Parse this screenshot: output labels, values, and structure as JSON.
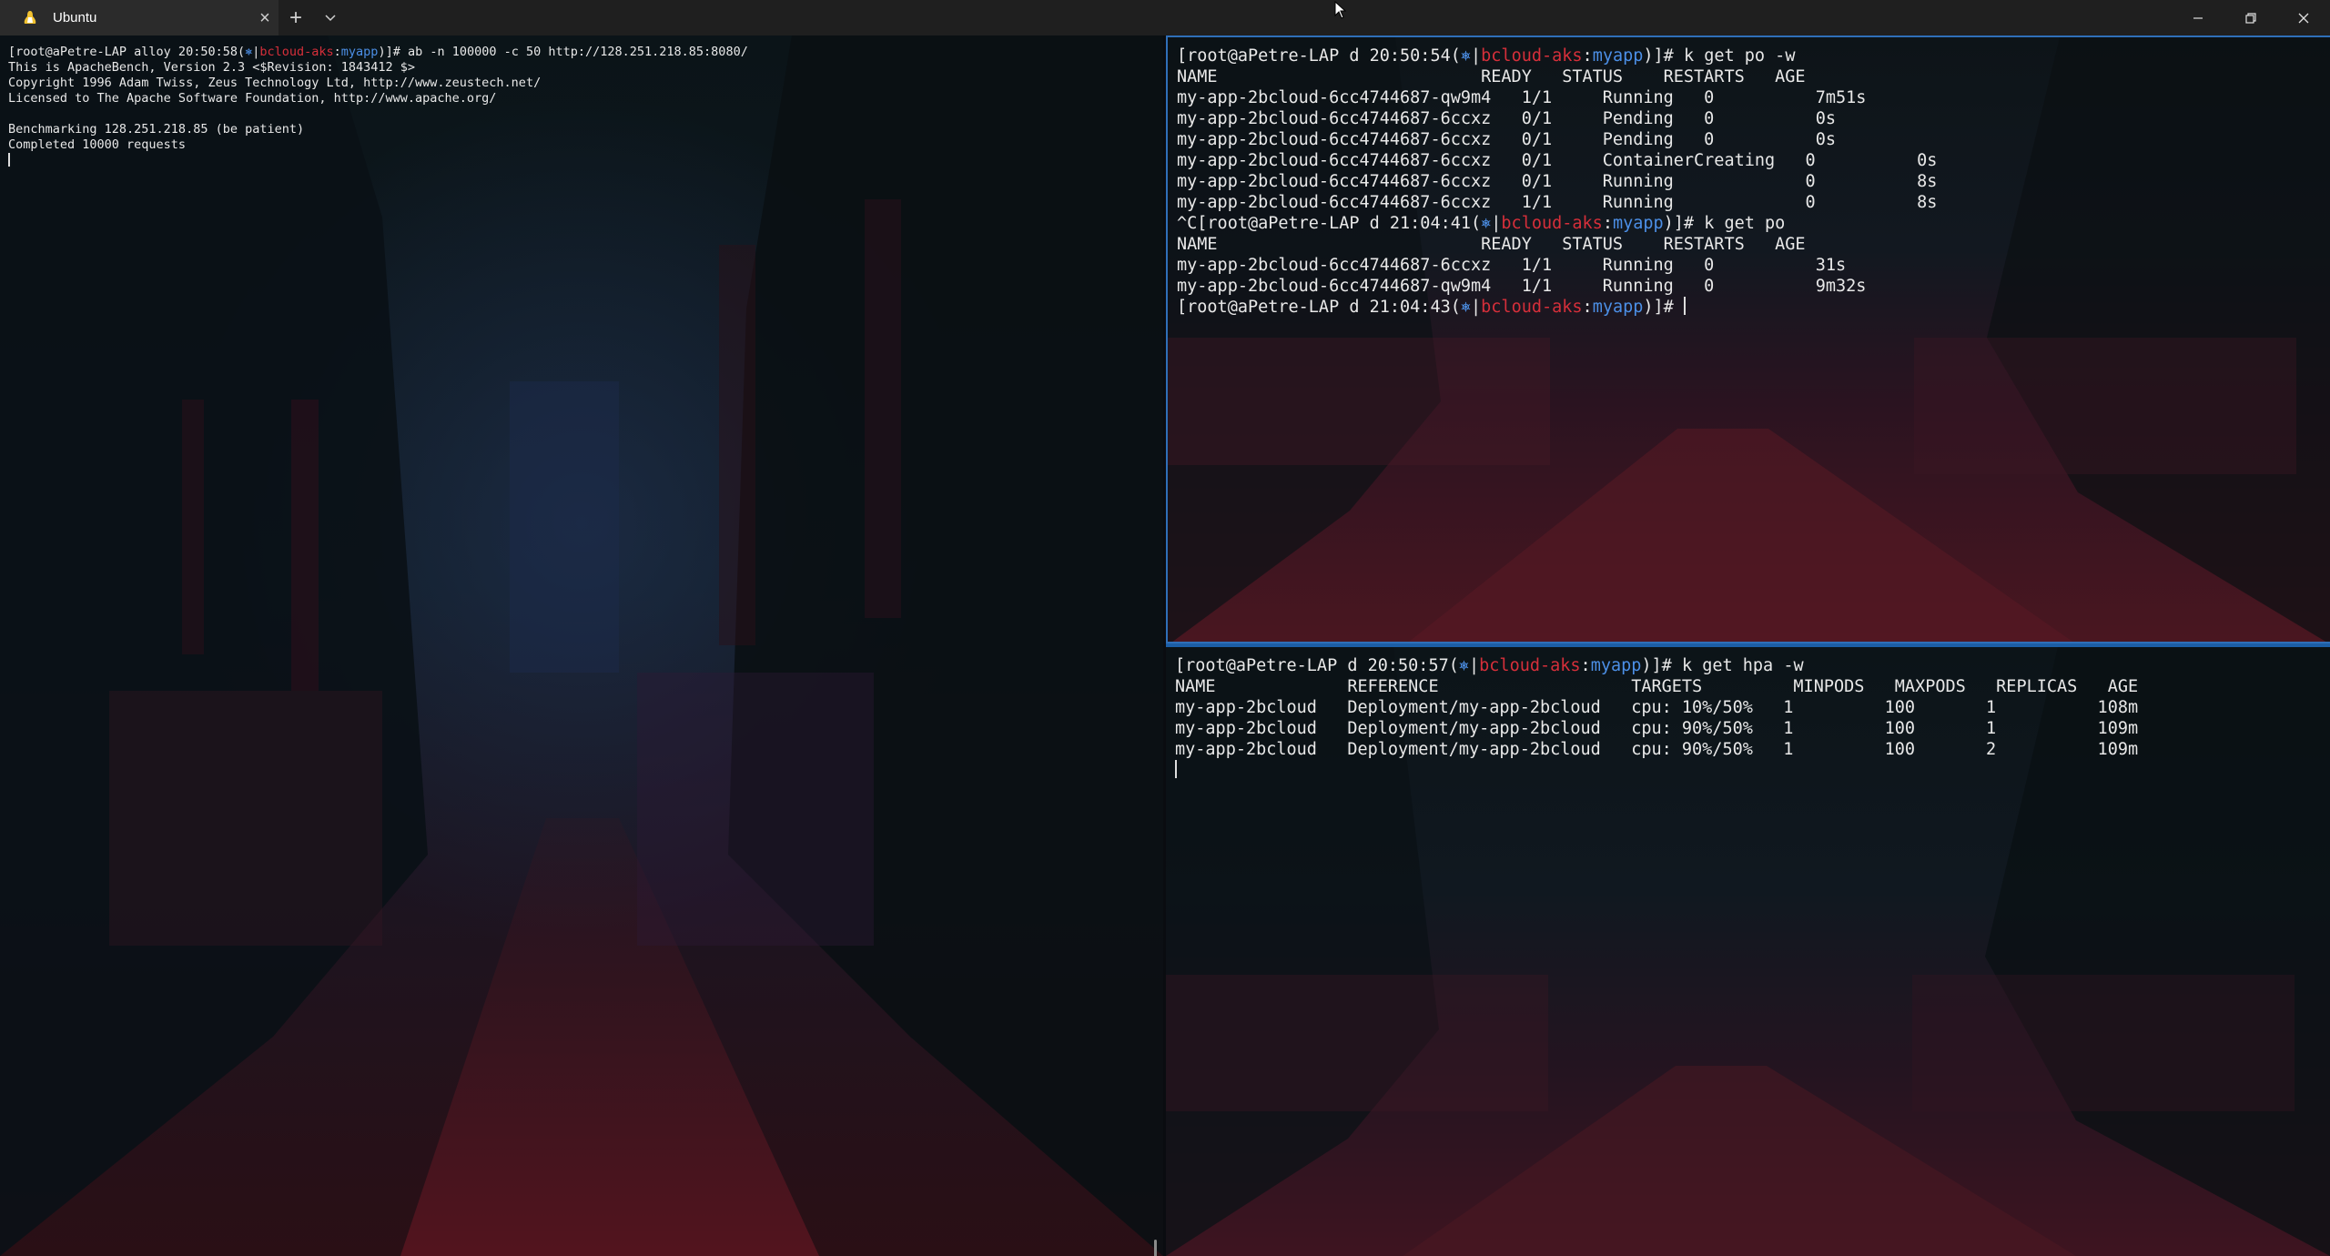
{
  "window": {
    "tab_title": "Ubuntu",
    "tab_icon": "tux-linux-icon",
    "tab_close": "×",
    "new_tab": "+",
    "dropdown": "⌄",
    "accent_color": "#2f6fb8"
  },
  "left_pane": {
    "lines": [
      {
        "pre": "[root@aPetre-LAP alloy 20:50:58(",
        "ctx_icon": "⎈",
        "bar": "|",
        "cluster": "bcloud-aks",
        "sep": ":",
        "ns": "myapp",
        "post": ")]# ab -n 100000 -c 50 http://128.251.218.85:8080/"
      },
      {
        "text": "This is ApacheBench, Version 2.3 <$Revision: 1843412 $>"
      },
      {
        "text": "Copyright 1996 Adam Twiss, Zeus Technology Ltd, http://www.zeustech.net/"
      },
      {
        "text": "Licensed to The Apache Software Foundation, http://www.apache.org/"
      },
      {
        "text": ""
      },
      {
        "text": "Benchmarking 128.251.218.85 (be patient)"
      },
      {
        "text": "Completed 10000 requests"
      }
    ]
  },
  "top_right_pane": {
    "lines": [
      {
        "pre": "[root@aPetre-LAP d 20:50:54(",
        "ctx_icon": "⎈",
        "bar": "|",
        "cluster": "bcloud-aks",
        "sep": ":",
        "ns": "myapp",
        "post": ")]# k get po -w"
      },
      {
        "text": "NAME                          READY   STATUS    RESTARTS   AGE"
      },
      {
        "text": "my-app-2bcloud-6cc4744687-qw9m4   1/1     Running   0          7m51s"
      },
      {
        "text": "my-app-2bcloud-6cc4744687-6ccxz   0/1     Pending   0          0s"
      },
      {
        "text": "my-app-2bcloud-6cc4744687-6ccxz   0/1     Pending   0          0s"
      },
      {
        "text": "my-app-2bcloud-6cc4744687-6ccxz   0/1     ContainerCreating   0          0s"
      },
      {
        "text": "my-app-2bcloud-6cc4744687-6ccxz   0/1     Running             0          8s"
      },
      {
        "text": "my-app-2bcloud-6cc4744687-6ccxz   1/1     Running             0          8s"
      },
      {
        "pre": "^C[root@aPetre-LAP d 21:04:41(",
        "ctx_icon": "⎈",
        "bar": "|",
        "cluster": "bcloud-aks",
        "sep": ":",
        "ns": "myapp",
        "post": ")]# k get po"
      },
      {
        "text": "NAME                          READY   STATUS    RESTARTS   AGE"
      },
      {
        "text": "my-app-2bcloud-6cc4744687-6ccxz   1/1     Running   0          31s"
      },
      {
        "text": "my-app-2bcloud-6cc4744687-qw9m4   1/1     Running   0          9m32s"
      },
      {
        "pre": "[root@aPetre-LAP d 21:04:43(",
        "ctx_icon": "⎈",
        "bar": "|",
        "cluster": "bcloud-aks",
        "sep": ":",
        "ns": "myapp",
        "post": ")]# ",
        "cursor": true
      }
    ]
  },
  "bottom_right_pane": {
    "lines": [
      {
        "pre": "[root@aPetre-LAP d 20:50:57(",
        "ctx_icon": "⎈",
        "bar": "|",
        "cluster": "bcloud-aks",
        "sep": ":",
        "ns": "myapp",
        "post": ")]# k get hpa -w"
      },
      {
        "text": "NAME             REFERENCE                   TARGETS         MINPODS   MAXPODS   REPLICAS   AGE"
      },
      {
        "text": "my-app-2bcloud   Deployment/my-app-2bcloud   cpu: 10%/50%   1         100       1          108m"
      },
      {
        "text": "my-app-2bcloud   Deployment/my-app-2bcloud   cpu: 90%/50%   1         100       1          109m"
      },
      {
        "text": "my-app-2bcloud   Deployment/my-app-2bcloud   cpu: 90%/50%   1         100       2          109m"
      },
      {
        "text": "",
        "cursor": true
      }
    ]
  }
}
